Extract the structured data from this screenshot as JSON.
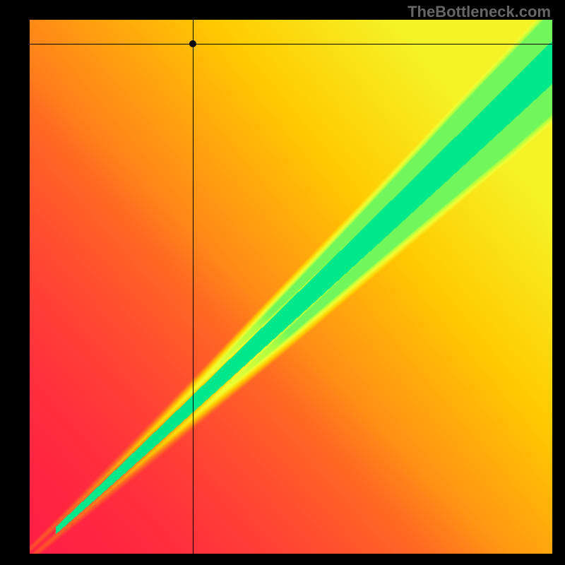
{
  "watermark": "TheBottleneck.com",
  "chart_data": {
    "type": "heatmap",
    "title": "",
    "xlabel": "",
    "ylabel": "",
    "xlim": [
      0,
      100
    ],
    "ylim": [
      0,
      100
    ],
    "colormap": [
      "#ff2244",
      "#ff7e22",
      "#ffff00",
      "#00e88a",
      "#00e88a"
    ],
    "description": "Gradient heatmap showing bottleneck zones with a diagonal green optimal band from bottom-left to upper-right, warm red/orange regions on sides.",
    "marker": {
      "x_pct": 31.2,
      "y_pct": 4.5
    },
    "crosshair": {
      "x_pct": 31.2,
      "y_pct": 4.5
    }
  }
}
